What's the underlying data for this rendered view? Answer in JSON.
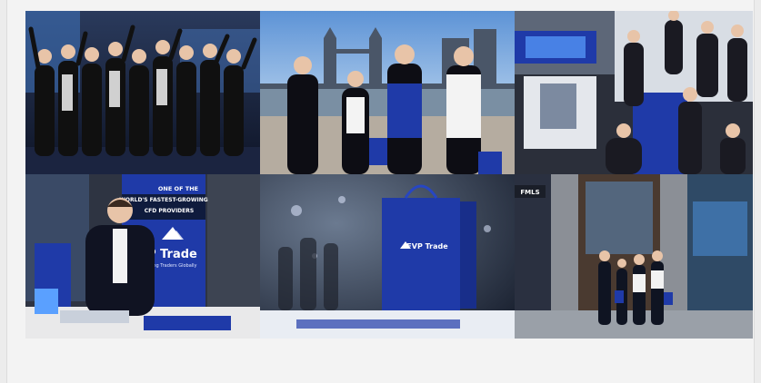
{
  "gallery": {
    "tiles": [
      {
        "id": "team-celebration",
        "icon": "photo-icon"
      },
      {
        "id": "tower-bridge-group",
        "icon": "photo-icon"
      },
      {
        "id": "expo-booth-crowd",
        "icon": "photo-icon"
      },
      {
        "id": "booth-presenter",
        "icon": "photo-icon",
        "banner_line1": "ONE OF THE",
        "banner_line2": "WORLD'S FASTEST-GROWING",
        "banner_line3": "CFD PROVIDERS",
        "brand_name": "FVP Trade",
        "brand_tagline": "Empowering Traders Globally"
      },
      {
        "id": "branded-bag",
        "icon": "photo-icon",
        "bag_brand": "FVP Trade"
      },
      {
        "id": "street-entrance",
        "icon": "photo-icon",
        "sign_text": "FMLS"
      }
    ],
    "colors": {
      "brand_blue": "#1f3aa8",
      "navy": "#0f1b3d",
      "background": "#f3f3f3"
    }
  }
}
